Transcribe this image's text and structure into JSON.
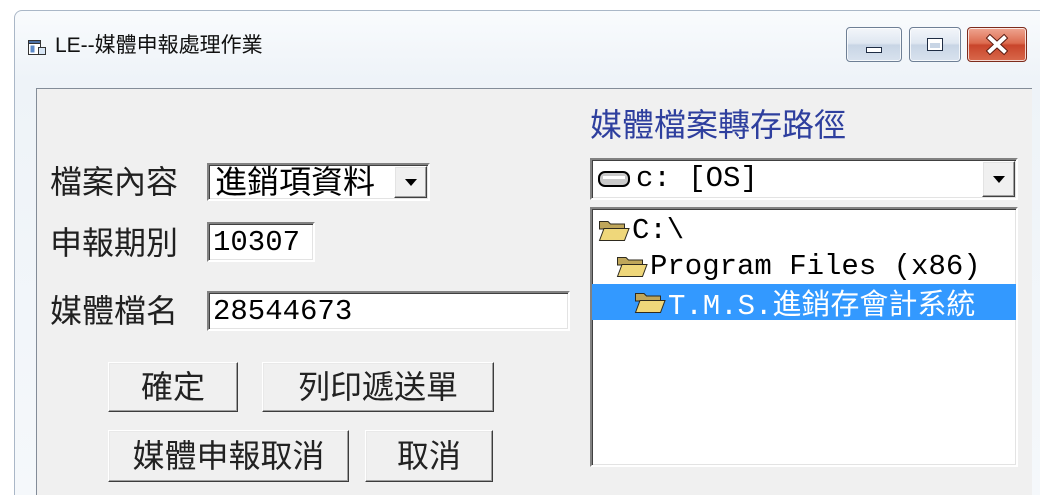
{
  "window": {
    "title": "LE--媒體申報處理作業",
    "icon": "app-icon",
    "controls": {
      "minimize": "minimize-icon",
      "maximize": "maximize-icon",
      "close": "close-icon"
    }
  },
  "form": {
    "file_content": {
      "label": "檔案內容",
      "value": "進銷項資料",
      "icon": "chevron-down-icon"
    },
    "period": {
      "label": "申報期別",
      "value": "10307"
    },
    "media_filename": {
      "label": "媒體檔名",
      "value": "28544673"
    }
  },
  "buttons": {
    "confirm": "確定",
    "print_transmittal": "列印遞送單",
    "cancel_report": "媒體申報取消",
    "cancel": "取消"
  },
  "path_panel": {
    "title": "媒體檔案轉存路徑",
    "drive": {
      "value": "c: [OS]",
      "icon": "drive-icon"
    },
    "directories": [
      {
        "name": "C:\\",
        "icon": "open-folder-icon",
        "level": 0,
        "selected": false
      },
      {
        "name": "Program Files (x86)",
        "icon": "open-folder-icon",
        "level": 1,
        "selected": false
      },
      {
        "name": "T.M.S.進銷存會計系統",
        "icon": "open-folder-icon",
        "level": 2,
        "selected": true
      }
    ]
  },
  "colors": {
    "selection": "#3399ff",
    "path_title": "#2e3f9e",
    "close_button": "#c9452b",
    "dialog_face": "#f0f0f0"
  }
}
